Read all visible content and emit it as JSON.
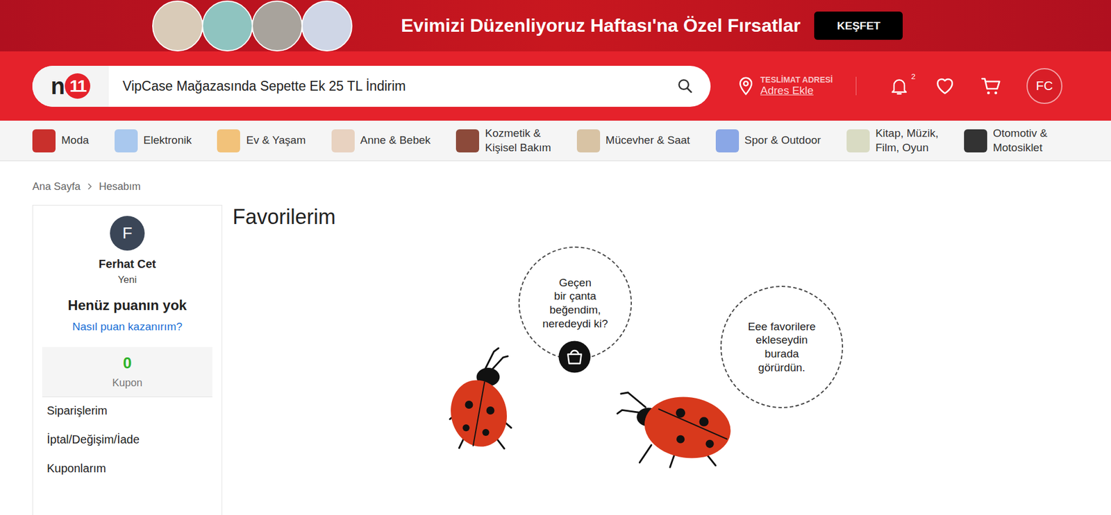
{
  "banner": {
    "title": "Evimizi Düzenliyoruz Haftası'na Özel Fırsatlar",
    "button": "KEŞFET"
  },
  "header": {
    "logo": {
      "letter": "n",
      "digits": "11"
    },
    "search": {
      "value": "VipCase Mağazasında Sepette Ek 25 TL İndirim"
    },
    "delivery": {
      "label": "TESLİMAT ADRESİ",
      "link": "Adres Ekle"
    },
    "notifications": {
      "count": "2"
    },
    "avatar": "FC"
  },
  "categories": [
    "Moda",
    "Elektronik",
    "Ev & Yaşam",
    "Anne & Bebek",
    "Kozmetik &\nKişisel Bakım",
    "Mücevher & Saat",
    "Spor & Outdoor",
    "Kitap, Müzik,\nFilm, Oyun",
    "Otomotiv &\nMotosiklet"
  ],
  "breadcrumb": [
    "Ana Sayfa",
    "Hesabım"
  ],
  "profile": {
    "initial": "F",
    "name": "Ferhat Cet",
    "level": "Yeni",
    "points": "Henüz puanın yok",
    "points_link": "Nasıl puan kazanırım?",
    "coupons": {
      "count": "0",
      "label": "Kupon"
    }
  },
  "account_menu": [
    "Siparişlerim",
    "İptal/Değişim/İade",
    "Kuponlarım"
  ],
  "page": {
    "title": "Favorilerim"
  },
  "empty_state": {
    "bubbles": [
      "Geçen\nbir çanta\nbeğendim,\nneredeydi ki?",
      "Eee favorilere\nekleseydin\nburada\ngörürdün."
    ]
  }
}
